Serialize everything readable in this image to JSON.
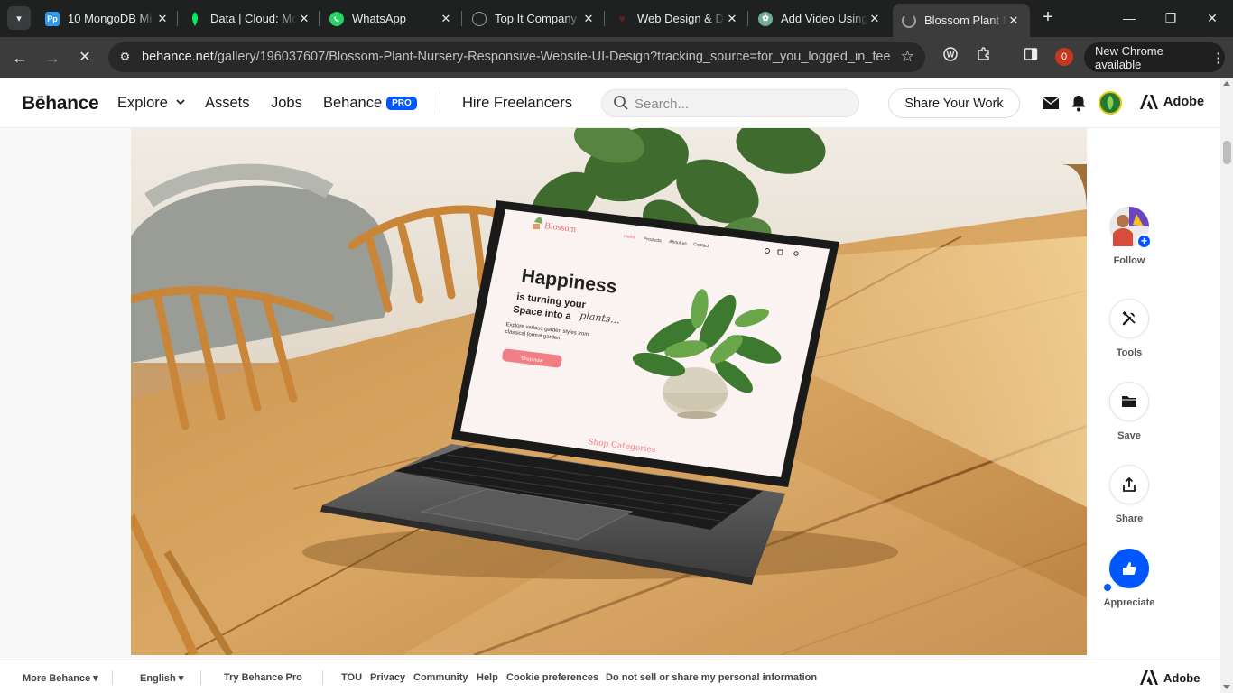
{
  "browser": {
    "tabs": [
      {
        "title": "10 MongoDB Mi",
        "favicon": "Pp",
        "favicon_color": "#2d9bf0"
      },
      {
        "title": "Data | Cloud: Mo",
        "favicon": "mongodb-leaf",
        "favicon_color": "#00684a"
      },
      {
        "title": "WhatsApp",
        "favicon": "whatsapp",
        "favicon_color": "#25d366"
      },
      {
        "title": "Top It Company",
        "favicon": "globe",
        "favicon_color": "#9aa0a6"
      },
      {
        "title": "Web Design & D",
        "favicon": "heart",
        "favicon_color": "#5a1a1a"
      },
      {
        "title": "Add Video Using",
        "favicon": "openai",
        "favicon_color": "#74aa9c"
      },
      {
        "title": "Blossom Plant N",
        "favicon": "loading",
        "favicon_color": "#9aa0a6"
      }
    ],
    "active_tab_index": 6,
    "url_host": "behance.net",
    "url_path": "/gallery/196037607/Blossom-Plant-Nursery-Responsive-Website-UI-Design?tracking_source=for_you_logged_in_feed_pu...",
    "notification_count": "0",
    "update_label": "New Chrome available"
  },
  "header": {
    "logo": "Bēhance",
    "nav": {
      "explore": "Explore",
      "assets": "Assets",
      "jobs": "Jobs",
      "behance": "Behance",
      "pro": "PRO",
      "hire": "Hire Freelancers"
    },
    "search_placeholder": "Search...",
    "share_work": "Share Your Work",
    "adobe": "Adobe"
  },
  "mockup": {
    "brand": "Blossom",
    "nav": [
      "Home",
      "Products",
      "About us",
      "Contact"
    ],
    "headline": "Happiness",
    "line2": "is turning your",
    "line3": "Space into a",
    "script_word": "plants...",
    "body": "Explore various garden styles from classical formal garden",
    "cta": "Shop now",
    "section_title": "Shop Categories"
  },
  "rail": {
    "follow": "Follow",
    "tools": "Tools",
    "save": "Save",
    "share": "Share",
    "appreciate": "Appreciate"
  },
  "footer": {
    "more": "More Behance",
    "language": "English",
    "try_pro": "Try Behance Pro",
    "tou": "TOU",
    "privacy": "Privacy",
    "community": "Community",
    "help": "Help",
    "cookies": "Cookie preferences",
    "donotsell": "Do not sell or share my personal information",
    "adobe": "Adobe"
  },
  "colors": {
    "behance_blue": "#0057ff",
    "chrome_dark": "#1f2020",
    "accent_pink": "#f27f86"
  }
}
